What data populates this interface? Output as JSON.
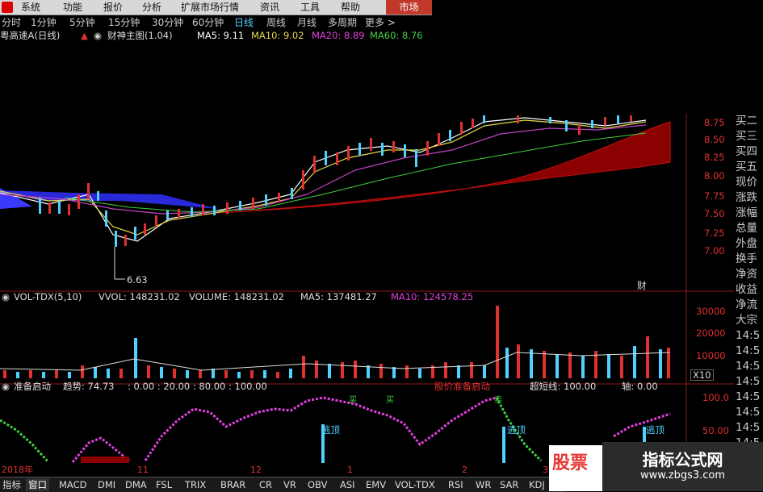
{
  "menu": {
    "items": [
      "系统",
      "功能",
      "报价",
      "分析",
      "扩展市场行情",
      "资讯",
      "工具",
      "帮助"
    ],
    "market_button": "市场"
  },
  "periods": {
    "items": [
      "分时",
      "1分钟",
      "5分钟",
      "15分钟",
      "30分钟",
      "60分钟",
      "日线",
      "周线",
      "月线",
      "多周期",
      "更多 >"
    ],
    "active": "日线"
  },
  "title": {
    "stock": "粤高速A(日线)",
    "indicator": "财神主图(1.04)",
    "ma5": "MA5: 9.11",
    "ma10": "MA10: 9.02",
    "ma20": "MA20: 8.89",
    "ma60": "MA60: 8.76"
  },
  "price_axis": [
    "8.75",
    "8.50",
    "8.25",
    "8.00",
    "7.75",
    "7.50",
    "7.25",
    "7.00"
  ],
  "annotations": {
    "low_price": "6.63",
    "cai_label": "财"
  },
  "volume_title": {
    "name": "VOL-TDX(5,10)",
    "vvol": "VVOL: 148231.02",
    "volume": "VOLUME: 148231.02",
    "ma5": "MA5: 137481.27",
    "ma10": "MA10: 124578.25"
  },
  "volume_axis": [
    "30000",
    "20000",
    "10000"
  ],
  "volume_unit": "X10",
  "indicator_title": {
    "name": "准备启动",
    "trend": "趋势: 74.73",
    "vals": ": 0.00 : 20.00 : 80.00 : 100.00",
    "pos": "股价准备启动",
    "super": "超短线: 100.00",
    "axis_label": "轴: 0.00"
  },
  "indicator_axis": [
    "100.0",
    "50.00"
  ],
  "indicator_tags": {
    "buy1": "买",
    "buy2": "买",
    "buy3": "卖",
    "escape": "逃顶"
  },
  "right_panel": [
    "买二",
    "买三",
    "买四",
    "买五",
    "现价",
    "涨跌",
    "涨幅",
    "总量",
    "外盘",
    "换手",
    "净资",
    "收益",
    "净流",
    "大宗",
    "14:5",
    "14:5",
    "14:5",
    "14:5",
    "14:5",
    "14:5",
    "14:5",
    "14:5",
    "14:5",
    "14:5"
  ],
  "dates": [
    "2018年",
    "11",
    "12",
    "1",
    "2",
    "3"
  ],
  "tabs": [
    "指标",
    "窗口",
    "MACD",
    "DMI",
    "DMA",
    "FSL",
    "TRIX",
    "BRAR",
    "CR",
    "VR",
    "OBV",
    "ASI",
    "EMV",
    "VOL-TDX",
    "RSI",
    "WR",
    "SAR",
    "KDJ",
    "C"
  ],
  "active_tab": "窗口",
  "watermarks": {
    "left": "股票",
    "right_title": "指标公式网",
    "right_url": "www.zbgs3.com"
  },
  "colors": {
    "up": "#e03030",
    "down": "#4fd0ff",
    "ma5": "#ffffff",
    "ma10": "#e6d84a",
    "ma20": "#c040c0",
    "ma60": "#40d040",
    "band": "#8b0000"
  },
  "chart_data": {
    "type": "line",
    "title": "粤高速A(日线)",
    "ylim": [
      6.5,
      9.0
    ],
    "x": [
      "2018年",
      "11",
      "12",
      "1",
      "2",
      "3"
    ],
    "series": [
      {
        "name": "MA5",
        "values": [
          7.65,
          7.2,
          7.55,
          8.2,
          8.6,
          8.85
        ]
      },
      {
        "name": "MA10",
        "values": [
          7.7,
          7.3,
          7.5,
          8.1,
          8.55,
          8.8
        ]
      },
      {
        "name": "MA20",
        "values": [
          7.75,
          7.45,
          7.5,
          7.95,
          8.4,
          8.75
        ]
      }
    ]
  }
}
